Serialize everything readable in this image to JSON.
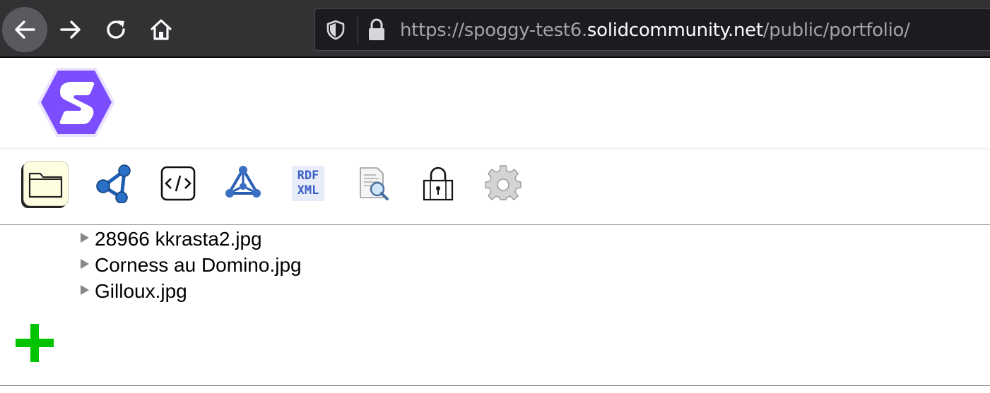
{
  "browser": {
    "url_scheme": "https://spoggy-test6.",
    "url_host": "solidcommunity.net",
    "url_path": "/public/portfolio/",
    "icons": [
      "back-arrow-icon",
      "forward-arrow-icon",
      "reload-icon",
      "home-icon",
      "shield-icon",
      "lock-icon"
    ]
  },
  "header": {
    "logo_icon": "solid-logo-icon",
    "logo_color": "#7c4dff"
  },
  "pane_tabs": [
    {
      "icon": "folder-icon",
      "selected": true
    },
    {
      "icon": "share-graph-icon",
      "selected": false
    },
    {
      "icon": "code-source-icon",
      "selected": false
    },
    {
      "icon": "triangle-graph-icon",
      "selected": false
    },
    {
      "icon": "rdf-xml-icon",
      "label_top": "RDF",
      "label_bottom": "XML",
      "selected": false
    },
    {
      "icon": "document-search-icon",
      "selected": false
    },
    {
      "icon": "padlock-icon",
      "selected": false
    },
    {
      "icon": "gear-icon",
      "selected": false
    }
  ],
  "files": [
    {
      "name": "28966 kkrasta2.jpg"
    },
    {
      "name": "Corness au Domino.jpg"
    },
    {
      "name": "Gilloux.jpg"
    }
  ],
  "add_button": {
    "icon": "plus-icon",
    "color": "#00c400"
  }
}
